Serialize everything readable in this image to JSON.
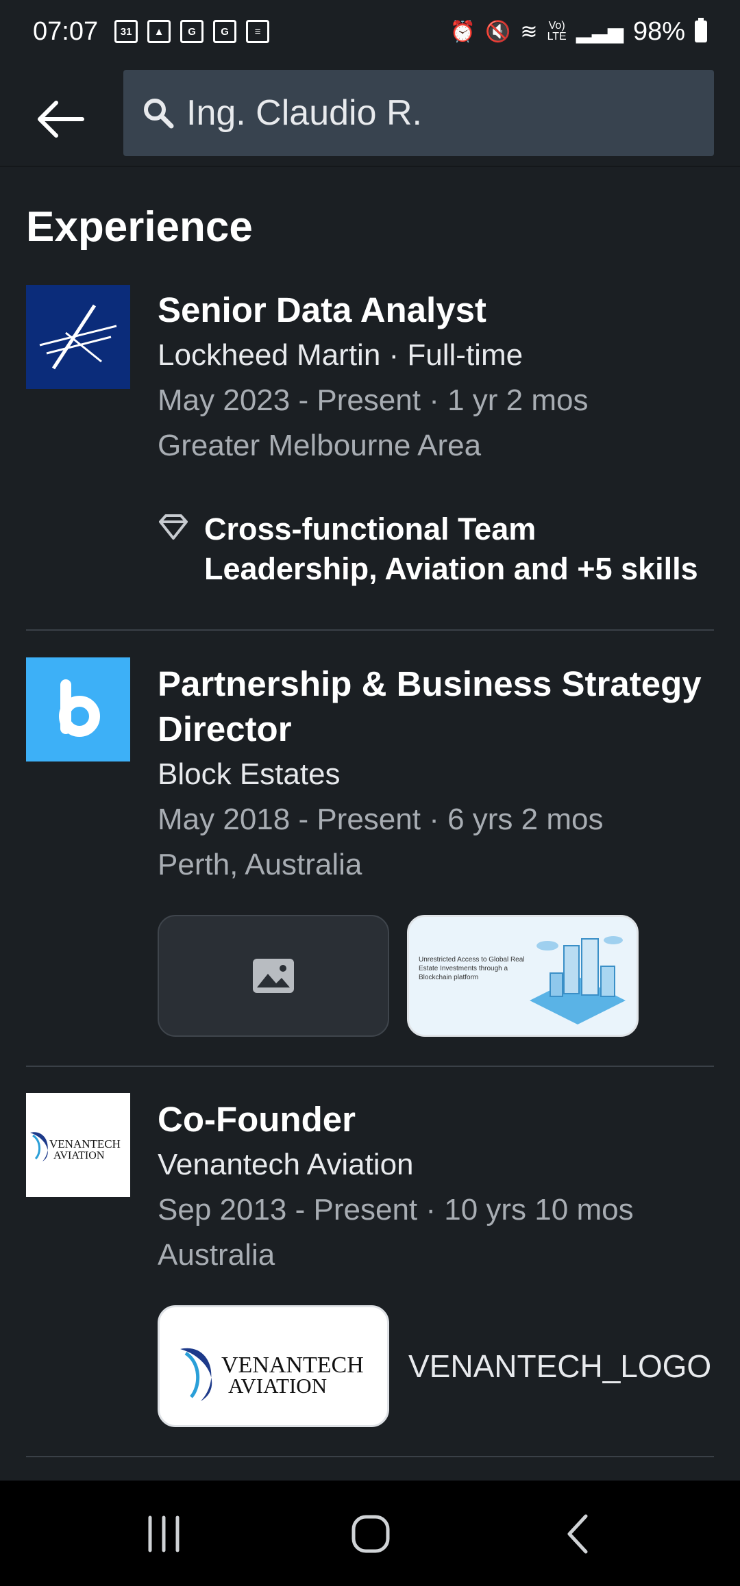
{
  "status_bar": {
    "time": "07:07",
    "notification_icons": [
      "calendar-icon",
      "gallery-icon",
      "news-icon",
      "news-icon",
      "clapper-icon"
    ],
    "calendar_day": "31",
    "battery": "98%"
  },
  "search": {
    "query": "Ing. Claudio R."
  },
  "section": {
    "title": "Experience"
  },
  "experience": [
    {
      "title": "Senior Data Analyst",
      "company": "Lockheed Martin · Full-time",
      "dates": "May 2023 - Present · 1 yr 2 mos",
      "location": "Greater Melbourne Area",
      "skills": "Cross-functional Team Leadership, Aviation and +5 skills"
    },
    {
      "title": "Partnership & Business Strategy Director",
      "company": "Block Estates",
      "dates": "May 2018 - Present · 6 yrs 2 mos",
      "location": "Perth, Australia",
      "media_caption": "Unrestricted Access to Global Real Estate Investments through a Blockchain platform"
    },
    {
      "title": "Co-Founder",
      "company": "Venantech Aviation",
      "dates": "Sep 2013 - Present · 10 yrs 10 mos",
      "location": "Australia",
      "logo_line1": "VENANTECH",
      "logo_line2": "AVIATION",
      "media_label": "VENANTECH_LOGO"
    }
  ],
  "colors": {
    "background": "#1b1f23",
    "search_bg": "#38434f",
    "block_estates_blue": "#3db0f7",
    "lockheed_navy": "#0b2c7a",
    "venantech_navy": "#1d3a8a"
  }
}
